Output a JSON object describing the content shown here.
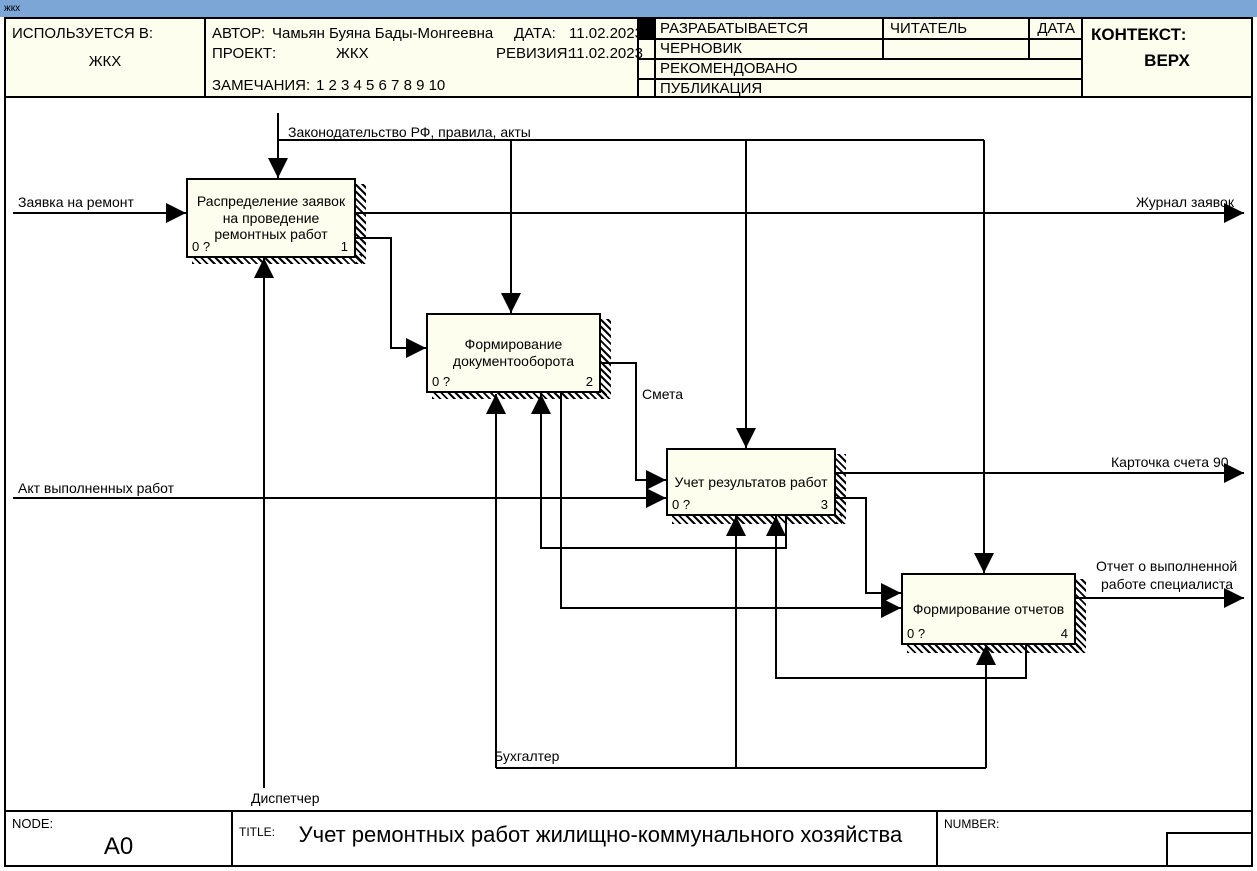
{
  "titlebar": "жкх",
  "header": {
    "used_in_label": "ИСПОЛЬЗУЕТСЯ В:",
    "used_in_value": "ЖКХ",
    "author_label": "АВТОР:",
    "author_value": "Чамьян Буяна Бады-Монгеевна",
    "date_label": "ДАТА:",
    "date_value": "11.02.2023",
    "project_label": "ПРОЕКТ:",
    "project_value": "ЖКХ",
    "revision_label": "РЕВИЗИЯ:",
    "revision_value": "11.02.2023",
    "notes_label": "ЗАМЕЧАНИЯ:",
    "notes_value": "1 2 3 4 5 6 7 8 9 10",
    "status": {
      "s1": "РАЗРАБАТЫВАЕТСЯ",
      "s2": "ЧЕРНОВИК",
      "s3": "РЕКОМЕНДОВАНО",
      "s4": "ПУБЛИКАЦИЯ",
      "reader": "ЧИТАТЕЛЬ",
      "date": "ДАТА"
    },
    "context_label": "КОНТЕКСТ:",
    "context_value": "ВЕРХ"
  },
  "footer": {
    "node_label": "NODE:",
    "node_value": "А0",
    "title_label": "TITLE:",
    "title_value": "Учет ремонтных работ жилищно-коммунального хозяйства",
    "number_label": "NUMBER:"
  },
  "diagram": {
    "top_input": "Законодательство РФ, правила, акты",
    "block1": {
      "title": "Распределение заявок на проведение ремонтных работ",
      "idx_l": "0 ?",
      "idx_r": "1"
    },
    "block2": {
      "title": "Формирование документооборота",
      "idx_l": "0 ?",
      "idx_r": "2"
    },
    "block3": {
      "title": "Учет результатов работ",
      "idx_l": "0 ?",
      "idx_r": "3"
    },
    "block4": {
      "title": "Формирование отчетов",
      "idx_l": "0 ?",
      "idx_r": "4"
    },
    "in1": "Заявка на ремонт",
    "in2": "Акт выполненных работ",
    "mid_label": "Смета",
    "out1": "Журнал заявок",
    "out2": "Карточка счета 90",
    "out3_l1": "Отчет о выполненной",
    "out3_l2": "работе специалиста",
    "mech1": "Диспетчер",
    "mech2": "Бухгалтер"
  }
}
